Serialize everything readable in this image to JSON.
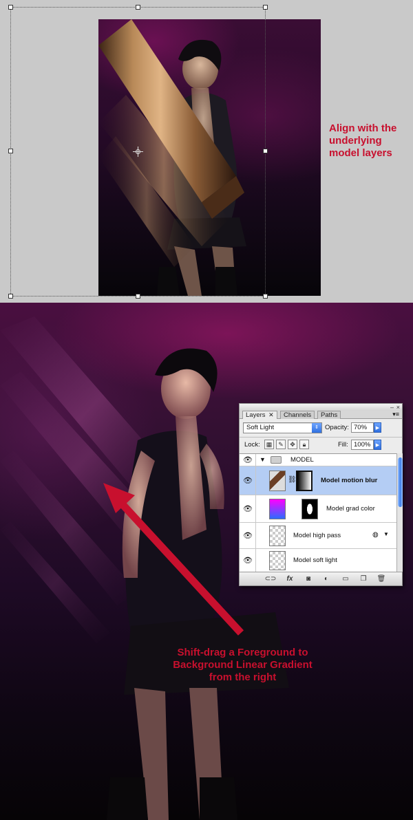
{
  "top_caption": "Align with the underlying model layers",
  "bottom_caption": "Shift-drag a Foreground to Background Linear Gradient from the right",
  "layers_panel": {
    "tabs": [
      "Layers",
      "Channels",
      "Paths"
    ],
    "tab_close": "✕",
    "blend_mode": "Soft Light",
    "opacity_label": "Opacity:",
    "opacity_value": "70%",
    "fill_label": "Fill:",
    "fill_value": "100%",
    "lock_label": "Lock:",
    "group_name": "MODEL",
    "layers": [
      {
        "name": "Model motion blur",
        "selected": true
      },
      {
        "name": "Model grad color",
        "selected": false
      },
      {
        "name": "Model high pass",
        "selected": false
      },
      {
        "name": "Model soft light",
        "selected": false
      }
    ],
    "bottom_icons": [
      "link-icon",
      "fx-icon",
      "mask-icon",
      "adjustment-icon",
      "folder-icon",
      "new-layer-icon",
      "trash-icon"
    ],
    "fx_label": "fx"
  },
  "colors": {
    "annotation_red": "#c8102e",
    "selected_row": "#b4cdf4",
    "canvas_gray": "#c9c9c9"
  }
}
